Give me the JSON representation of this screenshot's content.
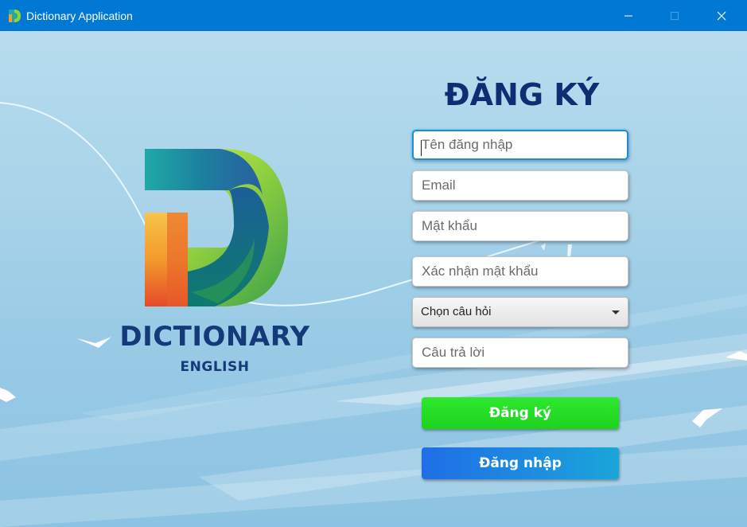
{
  "window": {
    "title": "Dictionary Application",
    "icon": "dictionary-d-icon",
    "controls": [
      "minimize-icon",
      "maximize-icon",
      "close-icon"
    ]
  },
  "brand": {
    "name": "DICTIONARY",
    "subtitle": "ENGLISH",
    "logo_icon": "dictionary-d-logo"
  },
  "form": {
    "title": "ĐĂNG KÝ",
    "username": {
      "placeholder": "Tên đăng nhập",
      "value": ""
    },
    "email": {
      "placeholder": "Email",
      "value": ""
    },
    "password": {
      "placeholder": "Mật khẩu",
      "value": ""
    },
    "confirm_password": {
      "placeholder": "Xác nhận mật khẩu",
      "value": ""
    },
    "question_select": {
      "selected": "Chọn câu hỏi"
    },
    "answer": {
      "placeholder": "Câu trả lời",
      "value": ""
    },
    "register_label": "Đăng ký",
    "login_label": "Đăng nhập"
  },
  "colors": {
    "titlebar": "#0078d4",
    "title_text": "#0e2d73",
    "register_button": "#22dd22",
    "login_button": "#1f7fe3"
  }
}
